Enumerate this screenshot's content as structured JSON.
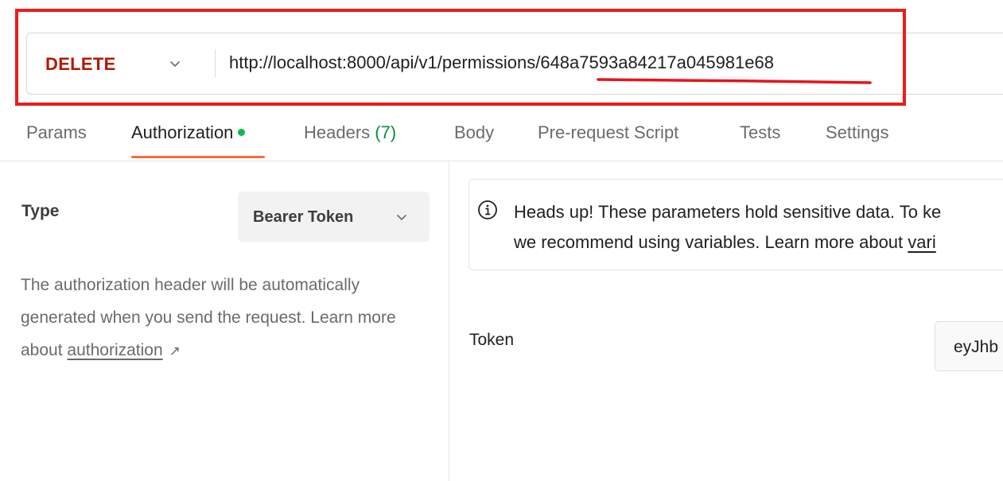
{
  "request": {
    "method": "DELETE",
    "url_base": "http://localhost:8000/api/v1/permissions/",
    "url_id": "648a7593a84217a045981e68"
  },
  "tabs": {
    "params": "Params",
    "authorization": "Authorization",
    "headers": "Headers",
    "headers_count": "(7)",
    "body": "Body",
    "prerequest": "Pre-request Script",
    "tests": "Tests",
    "settings": "Settings"
  },
  "auth": {
    "type_label": "Type",
    "type_value": "Bearer Token",
    "description": "The authorization header will be automatically generated when you send the request. Learn more about",
    "description_link": "authorization",
    "link_arrow": "↗"
  },
  "notice": {
    "line1": "Heads up! These parameters hold sensitive data. To ke",
    "line2_prefix": "we recommend using variables. Learn more about",
    "line2_link": "vari"
  },
  "token": {
    "label": "Token",
    "value": "eyJhb"
  },
  "colors": {
    "method": "#b41800",
    "active_tab_underline": "#ff6c37",
    "status_dot": "#0cbb52",
    "annotation": "#ee1c1c"
  }
}
